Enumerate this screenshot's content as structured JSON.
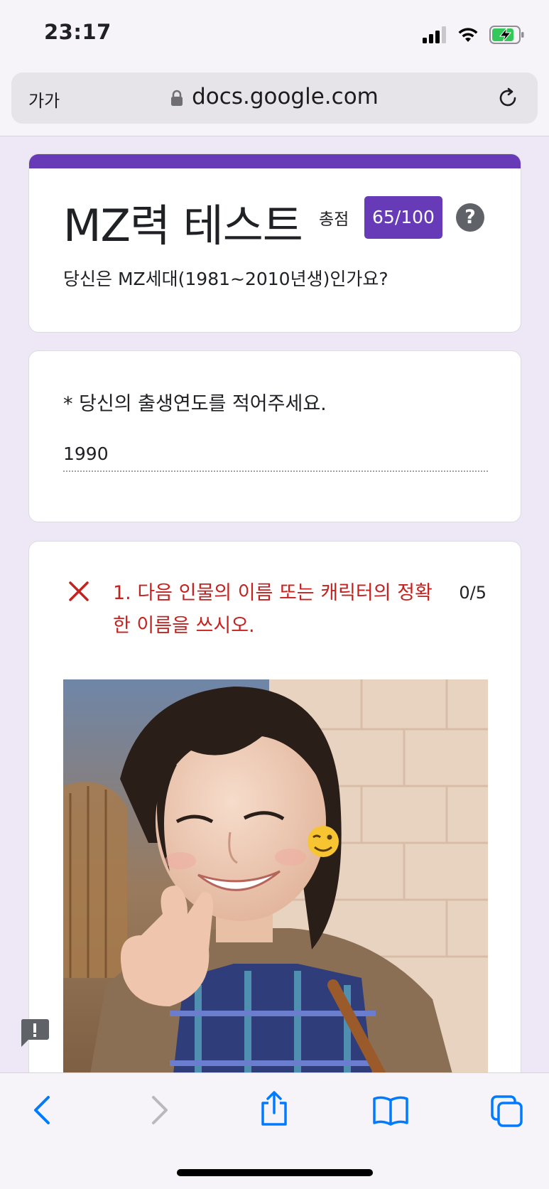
{
  "status_bar": {
    "time": "23:17"
  },
  "browser": {
    "text_size_label": "가가",
    "url": "docs.google.com"
  },
  "form": {
    "title": "MZ력 테스트",
    "score_label": "총점",
    "score": "65/100",
    "help": "?",
    "description": "당신은 MZ세대(1981~2010년생)인가요?",
    "accent_color": "#673ab7"
  },
  "birth_question": {
    "label": "* 당신의 출생연도를 적어주세요.",
    "answer": "1990"
  },
  "question1": {
    "text": "1. 다음 인물의 이름 또는 캐릭터의 정확한 이름을 쓰시오.",
    "points": "0/5",
    "result": "incorrect",
    "error_color": "#c5221f"
  },
  "toolbar": {
    "icons": [
      "back-icon",
      "forward-icon",
      "share-icon",
      "bookmarks-icon",
      "tabs-icon"
    ]
  }
}
